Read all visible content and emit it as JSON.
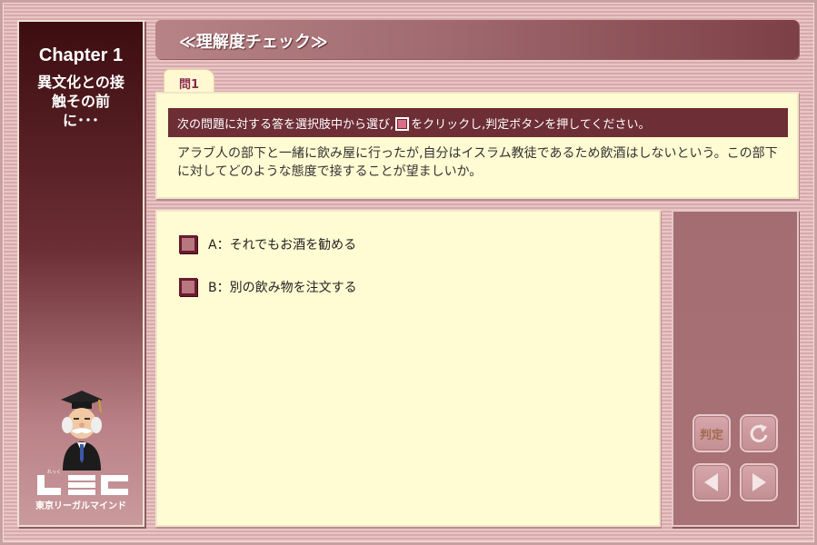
{
  "chapter": {
    "title": "Chapter 1",
    "subtitle_lines": [
      "異文化との接",
      "触その前",
      "に･･･"
    ]
  },
  "logo": {
    "caption": "東京リーガルマインド",
    "ruby": "れっく"
  },
  "header": {
    "title": "≪理解度チェック≫"
  },
  "question": {
    "tab_label": "問1",
    "instruction_before": "次の問題に対する答を選択肢中から選び,",
    "instruction_after": "をクリックし,判定ボタンを押してください。",
    "text": "アラブ人の部下と一緒に飲み屋に行ったが,自分はイスラム教徒であるため飲酒はしないという。この部下に対してどのような態度で接することが望ましいか。"
  },
  "choices": [
    {
      "label": "A：それでもお酒を勧める"
    },
    {
      "label": "B：別の飲み物を注文する"
    }
  ],
  "controls": {
    "judge_label": "判定",
    "reset_icon": "reset-icon",
    "prev_icon": "prev-arrow-icon",
    "next_icon": "next-arrow-icon"
  },
  "colors": {
    "accent_dark": "#6d2e36",
    "panel_cream": "#fffbd2",
    "tab_text": "#8a2a52"
  }
}
